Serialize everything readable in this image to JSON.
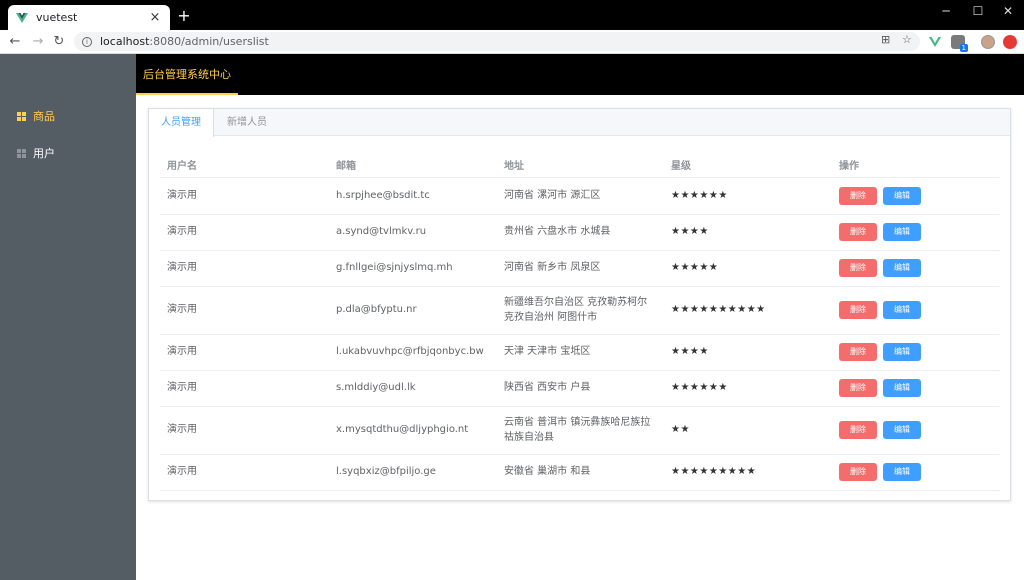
{
  "browser": {
    "tab_title": "vuetest",
    "tab_close": "×",
    "new_tab": "+",
    "url_host": "localhost",
    "url_path": ":8080/admin/userslist",
    "ext_badge": "1"
  },
  "colors": {
    "sidebar_bg": "#545c64",
    "accent": "#ffd04b",
    "primary": "#409eff",
    "danger": "#f56c6c"
  },
  "sidebar": {
    "items": [
      {
        "label": "商品",
        "icon": "grid-icon",
        "active": true
      },
      {
        "label": "用户",
        "icon": "grid-icon",
        "active": false
      }
    ]
  },
  "header": {
    "title": "后台管理系统中心"
  },
  "tabs": [
    {
      "label": "人员管理",
      "active": true
    },
    {
      "label": "新增人员",
      "active": false
    }
  ],
  "table": {
    "headers": [
      "用户名",
      "邮箱",
      "地址",
      "星级",
      "操作"
    ],
    "delete_label": "删除",
    "edit_label": "编辑",
    "rows": [
      {
        "name": "演示用",
        "email": "h.srpjhee@bsdit.tc",
        "address": "河南省 漯河市 源汇区",
        "stars": "★★★★★★"
      },
      {
        "name": "演示用",
        "email": "a.synd@tvlmkv.ru",
        "address": "贵州省 六盘水市 水城县",
        "stars": "★★★★"
      },
      {
        "name": "演示用",
        "email": "g.fnllgei@sjnjyslmq.mh",
        "address": "河南省 新乡市 凤泉区",
        "stars": "★★★★★"
      },
      {
        "name": "演示用",
        "email": "p.dla@bfyptu.nr",
        "address": "新疆维吾尔自治区 克孜勒苏柯尔克孜自治州 阿图什市",
        "stars": "★★★★★★★★★★"
      },
      {
        "name": "演示用",
        "email": "l.ukabvuvhpc@rfbjqonbyc.bw",
        "address": "天津 天津市 宝坻区",
        "stars": "★★★★"
      },
      {
        "name": "演示用",
        "email": "s.mlddiy@udl.lk",
        "address": "陕西省 西安市 户县",
        "stars": "★★★★★★"
      },
      {
        "name": "演示用",
        "email": "x.mysqtdthu@dljyphgio.nt",
        "address": "云南省 普洱市 镇沅彝族哈尼族拉祜族自治县",
        "stars": "★★"
      },
      {
        "name": "演示用",
        "email": "l.syqbxiz@bfpiljo.ge",
        "address": "安徽省 巢湖市 和县",
        "stars": "★★★★★★★★★"
      }
    ]
  }
}
